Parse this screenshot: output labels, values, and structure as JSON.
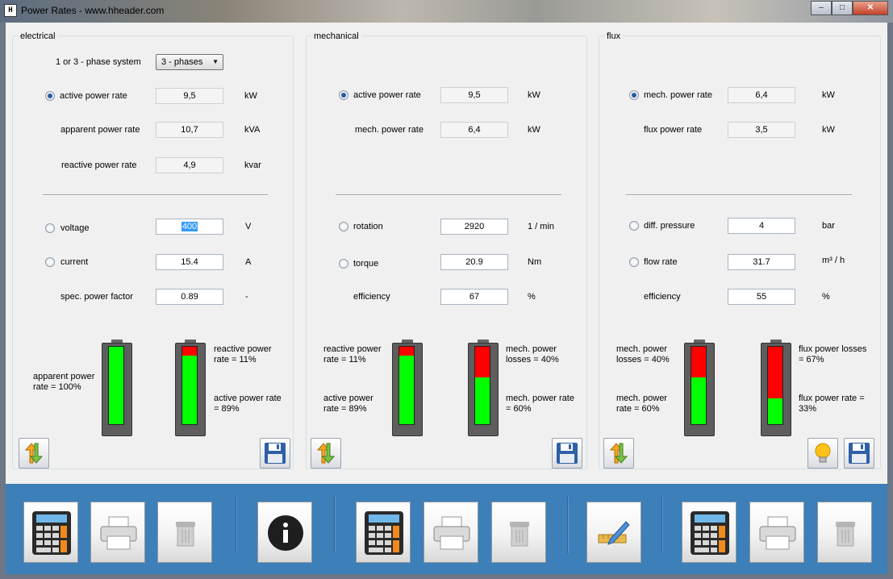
{
  "window": {
    "title": "Power Rates - www.hheader.com",
    "icon_text": "H",
    "min": "–",
    "max": "□",
    "close": "✕"
  },
  "electrical": {
    "title": "electrical",
    "phase_label": "1 or 3 - phase system",
    "phase_value": "3 - phases",
    "active_label": "active power rate",
    "active_value": "9,5",
    "active_unit": "kW",
    "apparent_label": "apparent power rate",
    "apparent_value": "10,7",
    "apparent_unit": "kVA",
    "reactive_label": "reactive power rate",
    "reactive_value": "4,9",
    "reactive_unit": "kvar",
    "voltage_label": "voltage",
    "voltage_value": "400",
    "voltage_unit": "V",
    "current_label": "current",
    "current_value": "15.4",
    "current_unit": "A",
    "pf_label": "spec. power factor",
    "pf_value": "0.89",
    "pf_unit": "-",
    "bat1_caption": "apparent power rate = 100%",
    "bat2_top": "reactive power rate = 11%",
    "bat2_bottom": "active power rate = 89%",
    "bat1_red_fraction": 0.0,
    "bat2_red_fraction": 0.11
  },
  "mechanical": {
    "title": "mechanical",
    "active_label": "active power rate",
    "active_value": "9,5",
    "active_unit": "kW",
    "mech_label": "mech. power rate",
    "mech_value": "6,4",
    "mech_unit": "kW",
    "rotation_label": "rotation",
    "rotation_value": "2920",
    "rotation_unit": "1 / min",
    "torque_label": "torque",
    "torque_value": "20.9",
    "torque_unit": "Nm",
    "eff_label": "efficiency",
    "eff_value": "67",
    "eff_unit": "%",
    "bat1_top": "reactive power rate = 11%",
    "bat1_bottom": "active power rate = 89%",
    "bat2_top": "mech. power losses = 40%",
    "bat2_bottom": "mech. power rate = 60%",
    "bat1_red_fraction": 0.11,
    "bat2_red_fraction": 0.4
  },
  "flux": {
    "title": "flux",
    "mech_label": "mech. power rate",
    "mech_value": "6,4",
    "mech_unit": "kW",
    "flux_label": "flux power rate",
    "flux_value": "3,5",
    "flux_unit": "kW",
    "dp_label": "diff. pressure",
    "dp_value": "4",
    "dp_unit": "bar",
    "flow_label": "flow rate",
    "flow_value": "31.7",
    "flow_unit": "m³ / h",
    "eff_label": "efficiency",
    "eff_value": "55",
    "eff_unit": "%",
    "bat1_top": "mech. power losses = 40%",
    "bat1_bottom": "mech. power rate = 60%",
    "bat2_top": "flux power losses = 67%",
    "bat2_bottom": "flux power rate = 33%",
    "bat1_red_fraction": 0.4,
    "bat2_red_fraction": 0.67
  },
  "colors": {
    "loss": "#ff0000",
    "useful": "#00ff00",
    "bottom_bar": "#3d7fb8"
  }
}
